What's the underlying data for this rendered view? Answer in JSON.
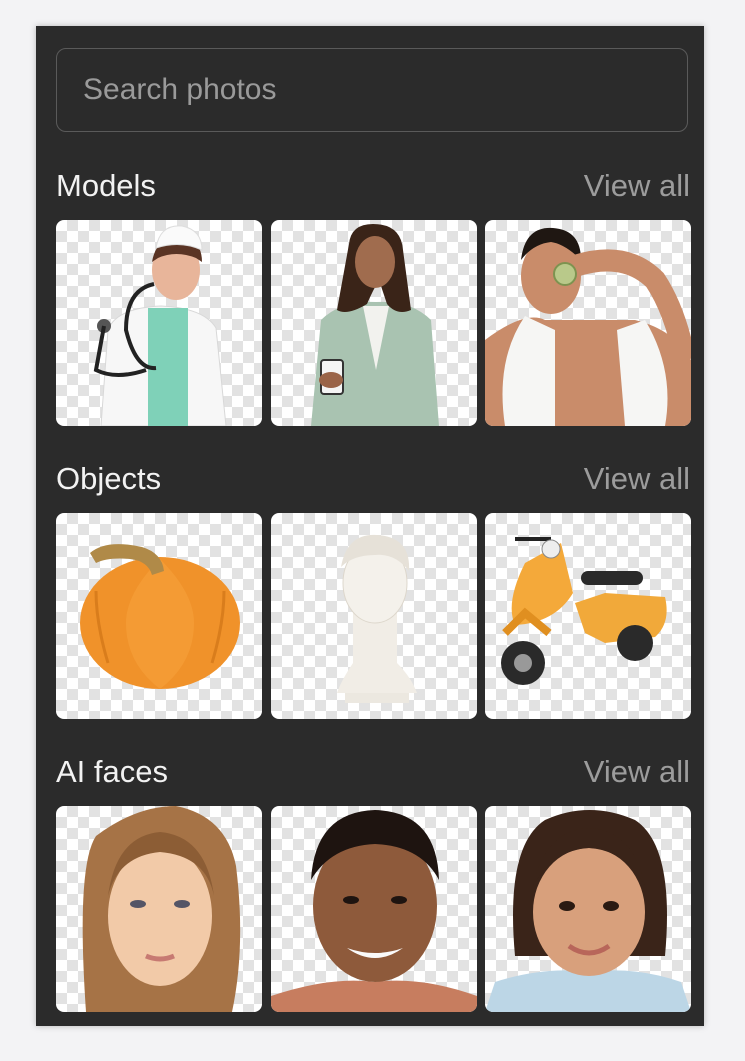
{
  "search": {
    "placeholder": "Search photos"
  },
  "sections": [
    {
      "title": "Models",
      "view_all": "View all",
      "items": [
        {
          "icon": "child-doctor-photo"
        },
        {
          "icon": "woman-in-blazer-photo"
        },
        {
          "icon": "man-with-cucumber-photo"
        }
      ]
    },
    {
      "title": "Objects",
      "view_all": "View all",
      "items": [
        {
          "icon": "pumpkin-photo"
        },
        {
          "icon": "bust-statue-photo"
        },
        {
          "icon": "scooter-photo"
        }
      ]
    },
    {
      "title": "AI faces",
      "view_all": "View all",
      "items": [
        {
          "icon": "woman-face-photo"
        },
        {
          "icon": "man-face-photo"
        },
        {
          "icon": "girl-face-photo"
        }
      ]
    }
  ],
  "colors": {
    "panel": "#2b2b2b",
    "heading": "#f2f2f2",
    "link": "#9c9c9c"
  }
}
